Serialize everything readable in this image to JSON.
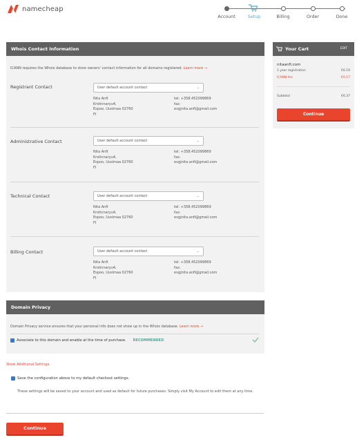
{
  "header": {
    "logo_text": "namecheap",
    "brand_color": "#e8452c",
    "steps": [
      {
        "label": "Account",
        "state": "done"
      },
      {
        "label": "Setup",
        "state": "active"
      },
      {
        "label": "Billing",
        "state": "todo"
      },
      {
        "label": "Order",
        "state": "todo"
      },
      {
        "label": "Done",
        "state": "todo"
      }
    ]
  },
  "whois": {
    "title": "Whois Contact Information",
    "intro": "ICANN requires the Whois database to store owners' contact information for all domains registered.",
    "intro_link": "Learn more →",
    "contacts": [
      {
        "label": "Registrant Contact",
        "select": "User default account contact",
        "name": "Nita Anfi",
        "street": "Krstinnaryu4,",
        "city": "Espoo, Uusimaa 02760",
        "country": "FI",
        "tel": "tel: +358.452099869",
        "fax": "fax:",
        "email": "evgjnita.anfi@gmail.com"
      },
      {
        "label": "Administrative Contact",
        "select": "User default account contact",
        "name": "Nita Anfi",
        "street": "Krstinnaryu4,",
        "city": "Espoo, Uusimaa 02760",
        "country": "FI",
        "tel": "tel: +358.452099869",
        "fax": "fax:",
        "email": "evgjnita.anfi@gmail.com"
      },
      {
        "label": "Technical Contact",
        "select": "User default account contact",
        "name": "Nita Anfi",
        "street": "Krstinnaryu4,",
        "city": "Espoo, Uusimaa 02760",
        "country": "FI",
        "tel": "tel: +358.452099869",
        "fax": "fax:",
        "email": "evgjnita.anfi@gmail.com"
      },
      {
        "label": "Billing Contact",
        "select": "User default account contact",
        "name": "Nita Anfi",
        "street": "Krstinnaryu4,",
        "city": "Espoo, Uusimaa 02760",
        "country": "FI",
        "tel": "tel: +358.452099869",
        "fax": "fax:",
        "email": "evgjnita.anfi@gmail.com"
      }
    ]
  },
  "privacy": {
    "title": "Domain Privacy",
    "text": "Domain Privacy service ensures that your personal info does not show up in the Whois database.",
    "link": "Learn more →",
    "checkbox_label": "Associate to this domain and enable at the time of purchase.",
    "recommended": "RECOMMENDED"
  },
  "settings": {
    "show_link": "Show Additional Settings",
    "save_label": "Save the configuration above to my default checkout settings.",
    "save_help": "These settings will be saved to your account and used as default for future purchases. Simply visit My Account to edit them at any time."
  },
  "continue_label": "Continue",
  "cart": {
    "title": "Your Cart",
    "edit": "EDIT",
    "domain": "nitaanfi.com",
    "items": [
      {
        "label": "1 year registration",
        "price": "€6.19"
      },
      {
        "label": "ICANN fee",
        "price": "€0.17"
      }
    ],
    "subtotal_label": "Subtotal",
    "subtotal": "€6.37",
    "continue_label": "Continue"
  }
}
